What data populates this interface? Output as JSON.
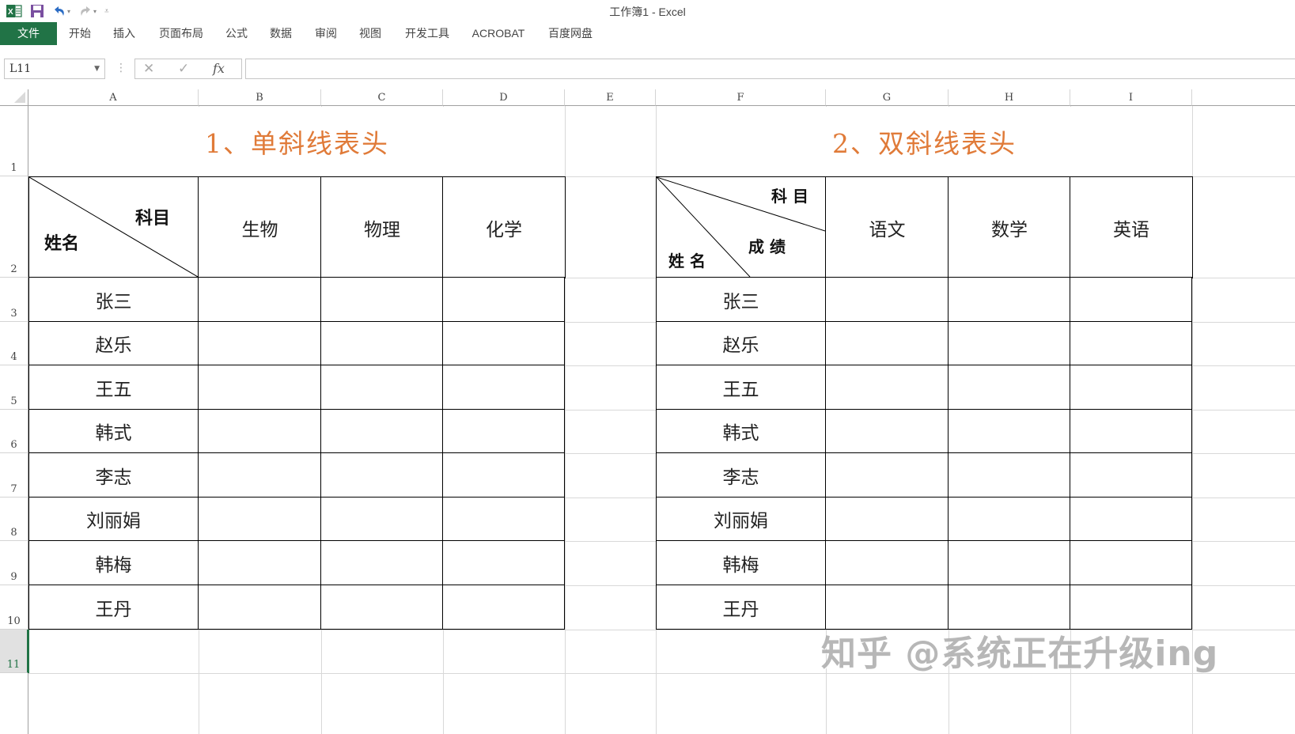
{
  "window": {
    "title": "工作簿1 - Excel",
    "qat": {
      "excel_icon": "excel-logo-icon",
      "save_icon": "save-icon",
      "undo_icon": "undo-icon",
      "redo_icon": "redo-icon",
      "customize_icon": "customize-qat-icon"
    }
  },
  "ribbon": {
    "tabs": [
      {
        "label": "文件",
        "active": true
      },
      {
        "label": "开始"
      },
      {
        "label": "插入"
      },
      {
        "label": "页面布局"
      },
      {
        "label": "公式"
      },
      {
        "label": "数据"
      },
      {
        "label": "审阅"
      },
      {
        "label": "视图"
      },
      {
        "label": "开发工具"
      },
      {
        "label": "ACROBAT"
      },
      {
        "label": "百度网盘"
      }
    ],
    "accent_color": "#217346"
  },
  "formula_bar": {
    "name_box": "L11",
    "cancel_glyph": "✕",
    "enter_glyph": "✓",
    "fx_glyph": "fx",
    "formula": ""
  },
  "grid": {
    "columns": [
      "A",
      "B",
      "C",
      "D",
      "E",
      "F",
      "G",
      "H",
      "I"
    ],
    "rows": [
      "1",
      "2",
      "3",
      "4",
      "5",
      "6",
      "7",
      "8",
      "9",
      "10",
      "11"
    ],
    "selected_row": "11",
    "selected_cell": "L11"
  },
  "table1": {
    "title": "1、单斜线表头",
    "diag_top": "科目",
    "diag_bottom": "姓名",
    "subjects": [
      "生物",
      "物理",
      "化学"
    ],
    "names": [
      "张三",
      "赵乐",
      "王五",
      "韩式",
      "李志",
      "刘丽娟",
      "韩梅",
      "王丹"
    ]
  },
  "table2": {
    "title": "2、双斜线表头",
    "diag_top": "科 目",
    "diag_middle": "成 绩",
    "diag_bottom": "姓 名",
    "subjects": [
      "语文",
      "数学",
      "英语"
    ],
    "names": [
      "张三",
      "赵乐",
      "王五",
      "韩式",
      "李志",
      "刘丽娟",
      "韩梅",
      "王丹"
    ]
  },
  "title_color": "#e07b39",
  "watermark": "知乎 @系统正在升级ing"
}
